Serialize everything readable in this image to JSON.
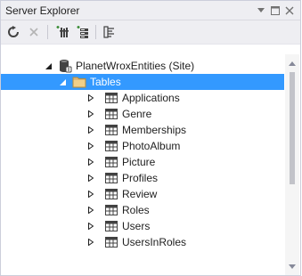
{
  "window": {
    "title": "Server Explorer"
  },
  "title_controls": [
    {
      "name": "dropdown-icon",
      "glyph": "▾"
    },
    {
      "name": "maximize-icon",
      "glyph": "□"
    },
    {
      "name": "close-icon",
      "glyph": "✕"
    }
  ],
  "toolbar": {
    "buttons": [
      {
        "name": "refresh-button",
        "icon": "refresh-icon",
        "enabled": true
      },
      {
        "name": "stop-refresh-button",
        "icon": "cancel-icon",
        "enabled": false
      },
      {
        "name": "connect-to-database-button",
        "icon": "connect-database-icon",
        "enabled": true
      },
      {
        "name": "connect-to-server-button",
        "icon": "connect-server-icon",
        "enabled": true
      },
      {
        "name": "properties-button",
        "icon": "properties-icon",
        "enabled": true
      }
    ]
  },
  "tree": {
    "root": {
      "label": "PlanetWroxEntities (Site)",
      "icon": "database-connection-icon",
      "expanded": true
    },
    "folder": {
      "label": "Tables",
      "icon": "folder-icon",
      "expanded": true,
      "selected": true
    },
    "tables": [
      {
        "label": "Applications"
      },
      {
        "label": "Genre"
      },
      {
        "label": "Memberships"
      },
      {
        "label": "PhotoAlbum"
      },
      {
        "label": "Picture"
      },
      {
        "label": "Profiles"
      },
      {
        "label": "Review"
      },
      {
        "label": "Roles"
      },
      {
        "label": "Users"
      },
      {
        "label": "UsersInRoles"
      }
    ]
  },
  "colors": {
    "selection": "#3399ff",
    "chrome": "#eeeef2",
    "border": "#cccedb"
  }
}
